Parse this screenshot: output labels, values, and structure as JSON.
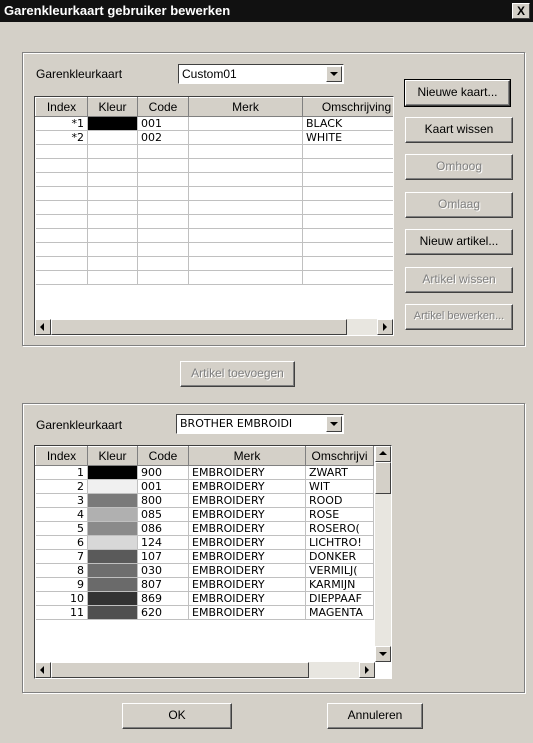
{
  "window": {
    "title": "Garenkleurkaart gebruiker bewerken",
    "close_label": "X"
  },
  "top": {
    "combo_label": "Garenkleurkaart",
    "combo_value": "Custom01",
    "columns": [
      "Index",
      "Kleur",
      "Code",
      "Merk",
      "Omschrijving"
    ],
    "rows": [
      {
        "index": "*1",
        "color": "#000000",
        "code": "001",
        "brand": "",
        "desc": "BLACK"
      },
      {
        "index": "*2",
        "color": "#ffffff",
        "code": "002",
        "brand": "",
        "desc": "WHITE"
      }
    ],
    "empty_rows": 10
  },
  "side_buttons": {
    "new_card": "Nieuwe kaart...",
    "delete_card": "Kaart wissen",
    "up": "Omhoog",
    "down": "Omlaag",
    "new_item": "Nieuw artikel...",
    "delete_item": "Artikel wissen",
    "edit_item": "Artikel bewerken..."
  },
  "add_item": "Artikel toevoegen",
  "bottom": {
    "combo_label": "Garenkleurkaart",
    "combo_value": "BROTHER EMBROIDI",
    "columns": [
      "Index",
      "Kleur",
      "Code",
      "Merk",
      "Omschrijvi"
    ],
    "rows": [
      {
        "index": "1",
        "color": "#000000",
        "code": "900",
        "brand": "EMBROIDERY",
        "desc": "ZWART"
      },
      {
        "index": "2",
        "color": "#f0f0f0",
        "code": "001",
        "brand": "EMBROIDERY",
        "desc": "WIT"
      },
      {
        "index": "3",
        "color": "#7a7a7a",
        "code": "800",
        "brand": "EMBROIDERY",
        "desc": "ROOD"
      },
      {
        "index": "4",
        "color": "#b0b0b0",
        "code": "085",
        "brand": "EMBROIDERY",
        "desc": "ROSE"
      },
      {
        "index": "5",
        "color": "#8a8a8a",
        "code": "086",
        "brand": "EMBROIDERY",
        "desc": "ROSERO("
      },
      {
        "index": "6",
        "color": "#d8d8d8",
        "code": "124",
        "brand": "EMBROIDERY",
        "desc": "LICHTRO!"
      },
      {
        "index": "7",
        "color": "#5a5a5a",
        "code": "107",
        "brand": "EMBROIDERY",
        "desc": "DONKER"
      },
      {
        "index": "8",
        "color": "#6e6e6e",
        "code": "030",
        "brand": "EMBROIDERY",
        "desc": "VERMILJ("
      },
      {
        "index": "9",
        "color": "#6a6a6a",
        "code": "807",
        "brand": "EMBROIDERY",
        "desc": "KARMIJN"
      },
      {
        "index": "10",
        "color": "#333333",
        "code": "869",
        "brand": "EMBROIDERY",
        "desc": "DIEPPAAF"
      },
      {
        "index": "11",
        "color": "#505050",
        "code": "620",
        "brand": "EMBROIDERY",
        "desc": "MAGENTA"
      }
    ]
  },
  "ok": "OK",
  "cancel": "Annuleren"
}
